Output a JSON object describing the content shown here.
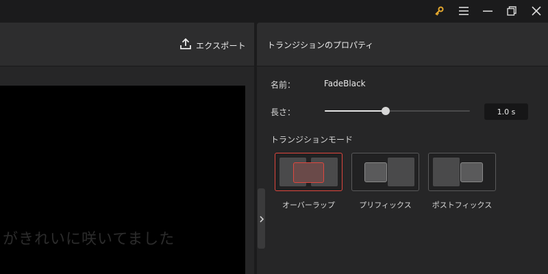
{
  "export": {
    "label": "エクスポート"
  },
  "preview": {
    "subtitle": "がきれいに咲いてました"
  },
  "properties": {
    "title": "トランジションのプロパティ",
    "name_label": "名前：",
    "name_value": "FadeBlack",
    "duration_label": "長さ：",
    "duration_value": "1.0 s",
    "duration_slider_fraction": 0.42,
    "mode_label": "トランジションモード",
    "modes": [
      {
        "label": "オーバーラップ",
        "selected": true
      },
      {
        "label": "プリフィックス",
        "selected": false
      },
      {
        "label": "ポストフィックス",
        "selected": false
      }
    ]
  },
  "colors": {
    "accent": "#e0473e",
    "key_icon": "#e5a82e"
  },
  "icons": {
    "titlebar": [
      "key-icon",
      "menu-icon",
      "minimize-icon",
      "restore-icon",
      "close-icon"
    ],
    "export": "upload-icon",
    "handle": "chevron-right-icon"
  }
}
